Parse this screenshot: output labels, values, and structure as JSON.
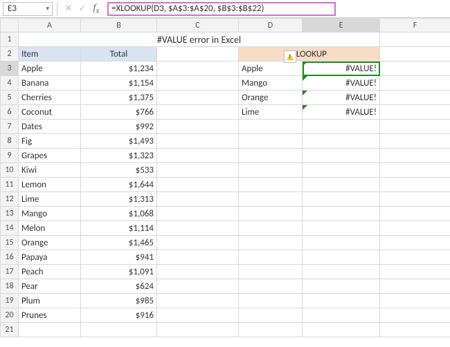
{
  "formula_bar": {
    "cell_ref": "E3",
    "formula": "=XLOOKUP(D3, $A$3:$A$20, $B$3:$B$22)"
  },
  "columns": [
    "A",
    "B",
    "C",
    "D",
    "E",
    "F"
  ],
  "title": "#VALUE error in Excel",
  "headers": {
    "item": "Item",
    "total": "Total",
    "xlookup": "XLOOKUP"
  },
  "items": [
    {
      "name": "Apple",
      "total": "$1,234"
    },
    {
      "name": "Banana",
      "total": "$1,154"
    },
    {
      "name": "Cherries",
      "total": "$1,375"
    },
    {
      "name": "Coconut",
      "total": "$766"
    },
    {
      "name": "Dates",
      "total": "$992"
    },
    {
      "name": "Fig",
      "total": "$1,493"
    },
    {
      "name": "Grapes",
      "total": "$1,323"
    },
    {
      "name": "Kiwi",
      "total": "$533"
    },
    {
      "name": "Lemon",
      "total": "$1,644"
    },
    {
      "name": "Lime",
      "total": "$1,313"
    },
    {
      "name": "Mango",
      "total": "$1,068"
    },
    {
      "name": "Melon",
      "total": "$1,114"
    },
    {
      "name": "Orange",
      "total": "$1,465"
    },
    {
      "name": "Papaya",
      "total": "$941"
    },
    {
      "name": "Peach",
      "total": "$1,091"
    },
    {
      "name": "Pear",
      "total": "$624"
    },
    {
      "name": "Plum",
      "total": "$985"
    },
    {
      "name": "Prunes",
      "total": "$916"
    }
  ],
  "lookup": [
    {
      "key": "Apple",
      "result": "#VALUE!"
    },
    {
      "key": "Mango",
      "result": "#VALUE!"
    },
    {
      "key": "Orange",
      "result": "#VALUE!"
    },
    {
      "key": "Lime",
      "result": "#VALUE!"
    }
  ],
  "row_numbers": [
    "1",
    "2",
    "3",
    "4",
    "5",
    "6",
    "7",
    "8",
    "9",
    "10",
    "11",
    "12",
    "13",
    "14",
    "15",
    "16",
    "17",
    "18",
    "19",
    "20",
    "21"
  ]
}
